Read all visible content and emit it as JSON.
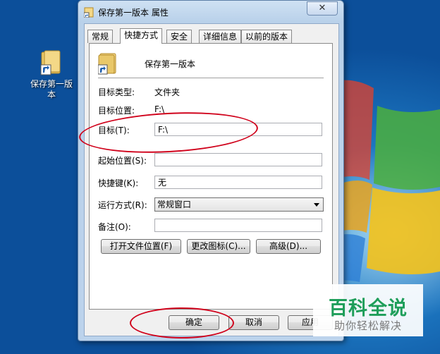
{
  "desktop": {
    "icon_label": "保存第一版本"
  },
  "window": {
    "title": "保存第一版本 属性",
    "close_glyph": "✕"
  },
  "tabs": [
    {
      "label": "常规"
    },
    {
      "label": "快捷方式"
    },
    {
      "label": "安全"
    },
    {
      "label": "详细信息"
    },
    {
      "label": "以前的版本"
    }
  ],
  "shortcut": {
    "name": "保存第一版本",
    "target_type_label": "目标类型:",
    "target_type_value": "文件夹",
    "target_location_label": "目标位置:",
    "target_location_value": "F:\\",
    "target_label": "目标(T):",
    "target_value": "F:\\",
    "start_in_label": "起始位置(S):",
    "start_in_value": "",
    "hotkey_label": "快捷键(K):",
    "hotkey_value": "无",
    "run_label": "运行方式(R):",
    "run_value": "常规窗口",
    "comment_label": "备注(O):",
    "comment_value": "",
    "open_location_button": "打开文件位置(F)",
    "change_icon_button": "更改图标(C)...",
    "advanced_button": "高级(D)..."
  },
  "footer": {
    "ok_button": "确定",
    "cancel_button": "取消",
    "apply_button": "应用"
  },
  "watermark": {
    "title": "百科全说",
    "subtitle": "助你轻松解决"
  },
  "colors": {
    "annotation_red": "#d0021b",
    "watermark_green": "#1e9e5a"
  }
}
